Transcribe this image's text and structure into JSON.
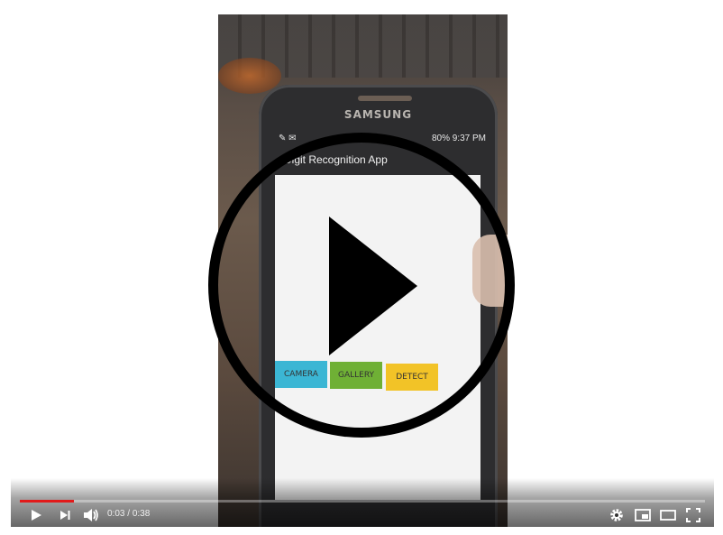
{
  "video": {
    "brand": "SAMSUNG",
    "status_time": "9:37 PM",
    "status_battery": "80%",
    "app_title": "Digit Recognition App",
    "buttons": {
      "camera": "CAMERA",
      "gallery": "GALLERY",
      "detect": "DETECT"
    }
  },
  "player": {
    "time_current": "0:03",
    "time_separator": " / ",
    "time_total": "0:38",
    "progress_fraction": 0.079,
    "progress_color": "#e21a1a"
  },
  "icons": {
    "play": "play-icon",
    "next": "next-icon",
    "volume": "volume-icon",
    "settings": "gear-icon",
    "miniplayer": "miniplayer-icon",
    "theater": "theater-icon",
    "fullscreen": "fullscreen-icon"
  }
}
